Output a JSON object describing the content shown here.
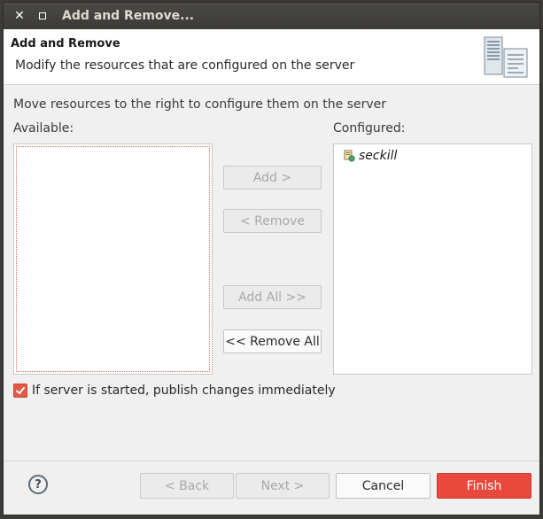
{
  "window": {
    "title": "Add and Remove..."
  },
  "header": {
    "title": "Add and Remove",
    "description": "Modify the resources that are configured on the server"
  },
  "instructions": "Move resources to the right to configure them on the server",
  "available": {
    "label": "Available:",
    "items": []
  },
  "configured": {
    "label": "Configured:",
    "items": [
      {
        "label": "seckill",
        "icon": "web-module-icon"
      }
    ]
  },
  "buttons": {
    "add": "Add >",
    "remove": "< Remove",
    "add_all": "Add All >>",
    "remove_all": "<< Remove All"
  },
  "publish_checkbox": {
    "label": "If server is started, publish changes immediately",
    "checked": true
  },
  "footer": {
    "help_glyph": "?",
    "back": "< Back",
    "next": "Next >",
    "cancel": "Cancel",
    "finish": "Finish"
  },
  "colors": {
    "accent": "#e9483c",
    "titlebar": "#3c3b37",
    "dialog_bg": "#f0f0f0"
  }
}
